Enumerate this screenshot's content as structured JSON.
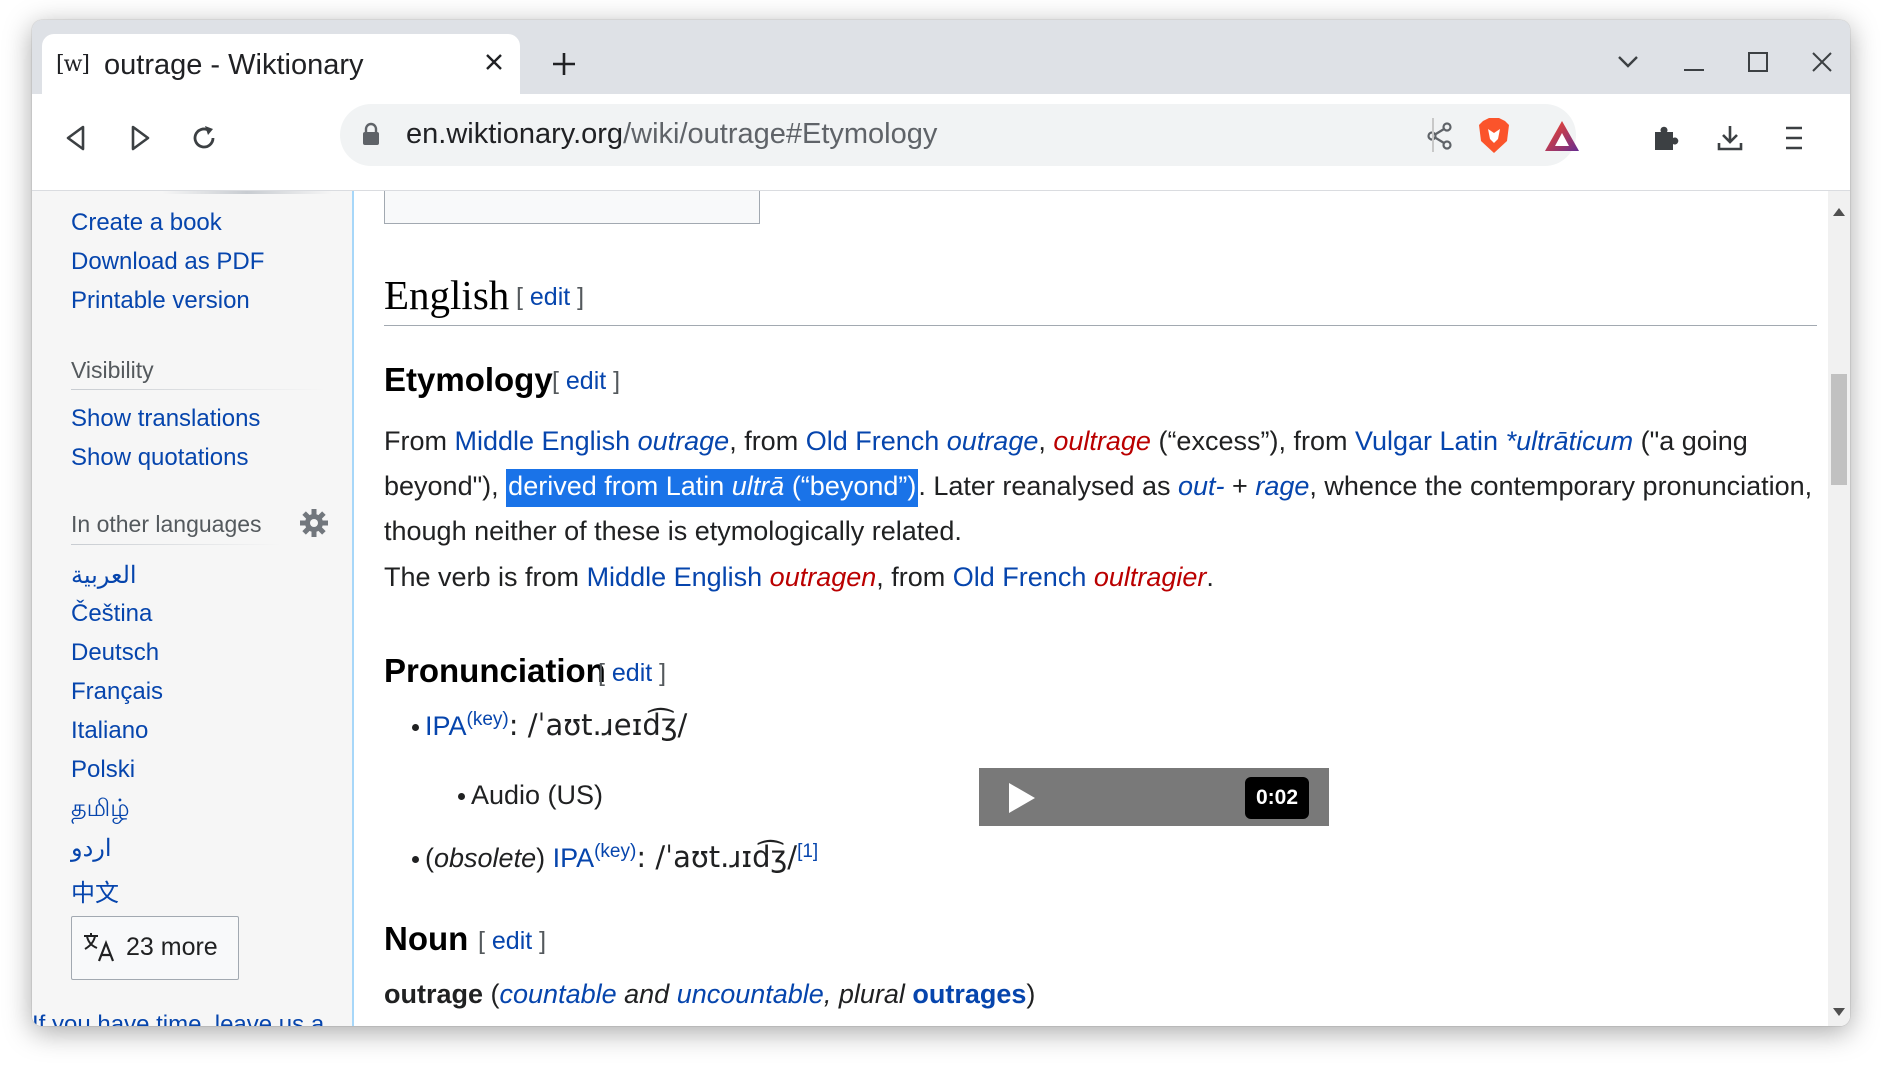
{
  "browser": {
    "tab_title": "outrage - Wiktionary",
    "favicon_text": "[w]",
    "url_host": "en.wiktionary.org",
    "url_path": "/wiki/outrage#Etymology"
  },
  "sidebar": {
    "tools_links": [
      "Create a book",
      "Download as PDF",
      "Printable version"
    ],
    "visibility_heading": "Visibility",
    "visibility_links": [
      "Show translations",
      "Show quotations"
    ],
    "languages_heading": "In other languages",
    "languages": [
      "العربية",
      "Čeština",
      "Deutsch",
      "Français",
      "Italiano",
      "Polski",
      "தமிழ்",
      "اردو",
      "中文"
    ],
    "more_button": "23 more",
    "feedback_link": "If you have time, leave us a"
  },
  "article": {
    "lang_heading": "English",
    "edit_label": "edit",
    "etymology_heading": "Etymology",
    "ety": {
      "t1": "From ",
      "l_me": "Middle English",
      "w_outrage1": "outrage",
      "t2": ", from ",
      "l_of": "Old French",
      "w_outrage2": "outrage",
      "t3": ", ",
      "w_oultrage": "oultrage",
      "t4": " (“excess”), from ",
      "l_vl": "Vulgar Latin",
      "w_ultraticum": "*ultrāticum",
      "t5": " (\"a going beyond\"), ",
      "sel1": "derived from Latin ",
      "sel_ultra": "ultrā",
      "sel2": " (“beyond”)",
      "t6": ". Later reanalysed as ",
      "w_out": "out-",
      "t7": " + ",
      "w_rage": "rage",
      "t8": ", whence the contemporary pronunciation, though neither of these is etymologically related."
    },
    "verb": {
      "t1": "The verb is from ",
      "l_me": "Middle English",
      "w_outragen": "outragen",
      "t2": ", from ",
      "l_of": "Old French",
      "w_oultragier": "oultragier",
      "t3": "."
    },
    "pronunciation_heading": "Pronunciation",
    "pron1": {
      "ipa_link": "IPA",
      "key": "(key)",
      "ipa": ": /ˈaʊt.ɹeɪd͡ʒ/"
    },
    "audio": {
      "label": "Audio (US)",
      "time": "0:02"
    },
    "pron2": {
      "paren_open": "(",
      "obsolete": "obsolete",
      "paren_close": ") ",
      "ipa_link": "IPA",
      "key": "(key)",
      "ipa": ": /ˈaʊt.ɹɪd͡ʒ/",
      "ref": "[1]"
    },
    "noun_heading": "Noun",
    "noun_line": {
      "word": "outrage",
      "t1": " (",
      "countable": "countable",
      "and": " and ",
      "uncountable": "uncountable",
      "plural": ", plural ",
      "outrages": "outrages",
      "t2": ")"
    }
  }
}
